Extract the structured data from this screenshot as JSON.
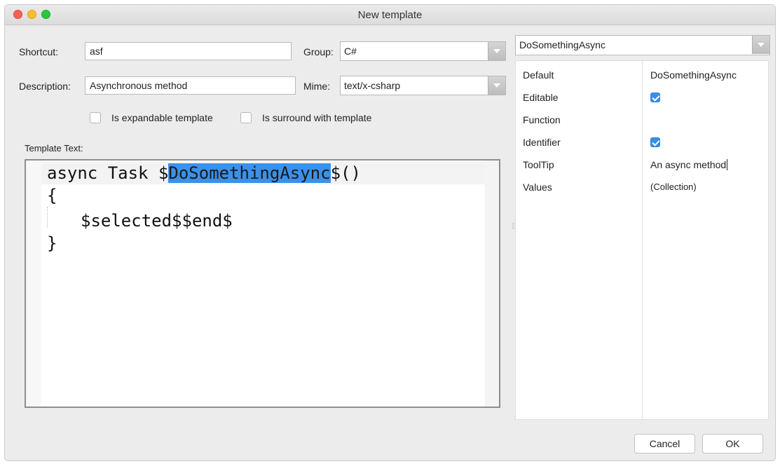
{
  "window": {
    "title": "New template"
  },
  "form": {
    "shortcut_label": "Shortcut:",
    "shortcut_value": "asf",
    "group_label": "Group:",
    "group_value": "C#",
    "description_label": "Description:",
    "description_value": "Asynchronous method",
    "mime_label": "Mime:",
    "mime_value": "text/x-csharp",
    "expandable_label": "Is expandable template",
    "expandable_checked": false,
    "surround_label": "Is surround with template",
    "surround_checked": false
  },
  "editor": {
    "label": "Template Text:",
    "line1_before": "async Task $",
    "line1_selected": "DoSomethingAsync",
    "line1_after": "$()",
    "line2": "{",
    "line3": "$selected$$end$",
    "line4": "}"
  },
  "variables": {
    "selected_variable": "DoSomethingAsync",
    "properties": [
      {
        "name": "Default",
        "value": "DoSomethingAsync"
      },
      {
        "name": "Editable",
        "checked": true
      },
      {
        "name": "Function",
        "value": ""
      },
      {
        "name": "Identifier",
        "checked": true
      },
      {
        "name": "ToolTip",
        "value": "An async method"
      },
      {
        "name": "Values",
        "value": "(Collection)"
      }
    ]
  },
  "buttons": {
    "cancel": "Cancel",
    "ok": "OK"
  },
  "colors": {
    "selection": "#3a91ea",
    "checkbox_checked": "#3a8ee6"
  }
}
